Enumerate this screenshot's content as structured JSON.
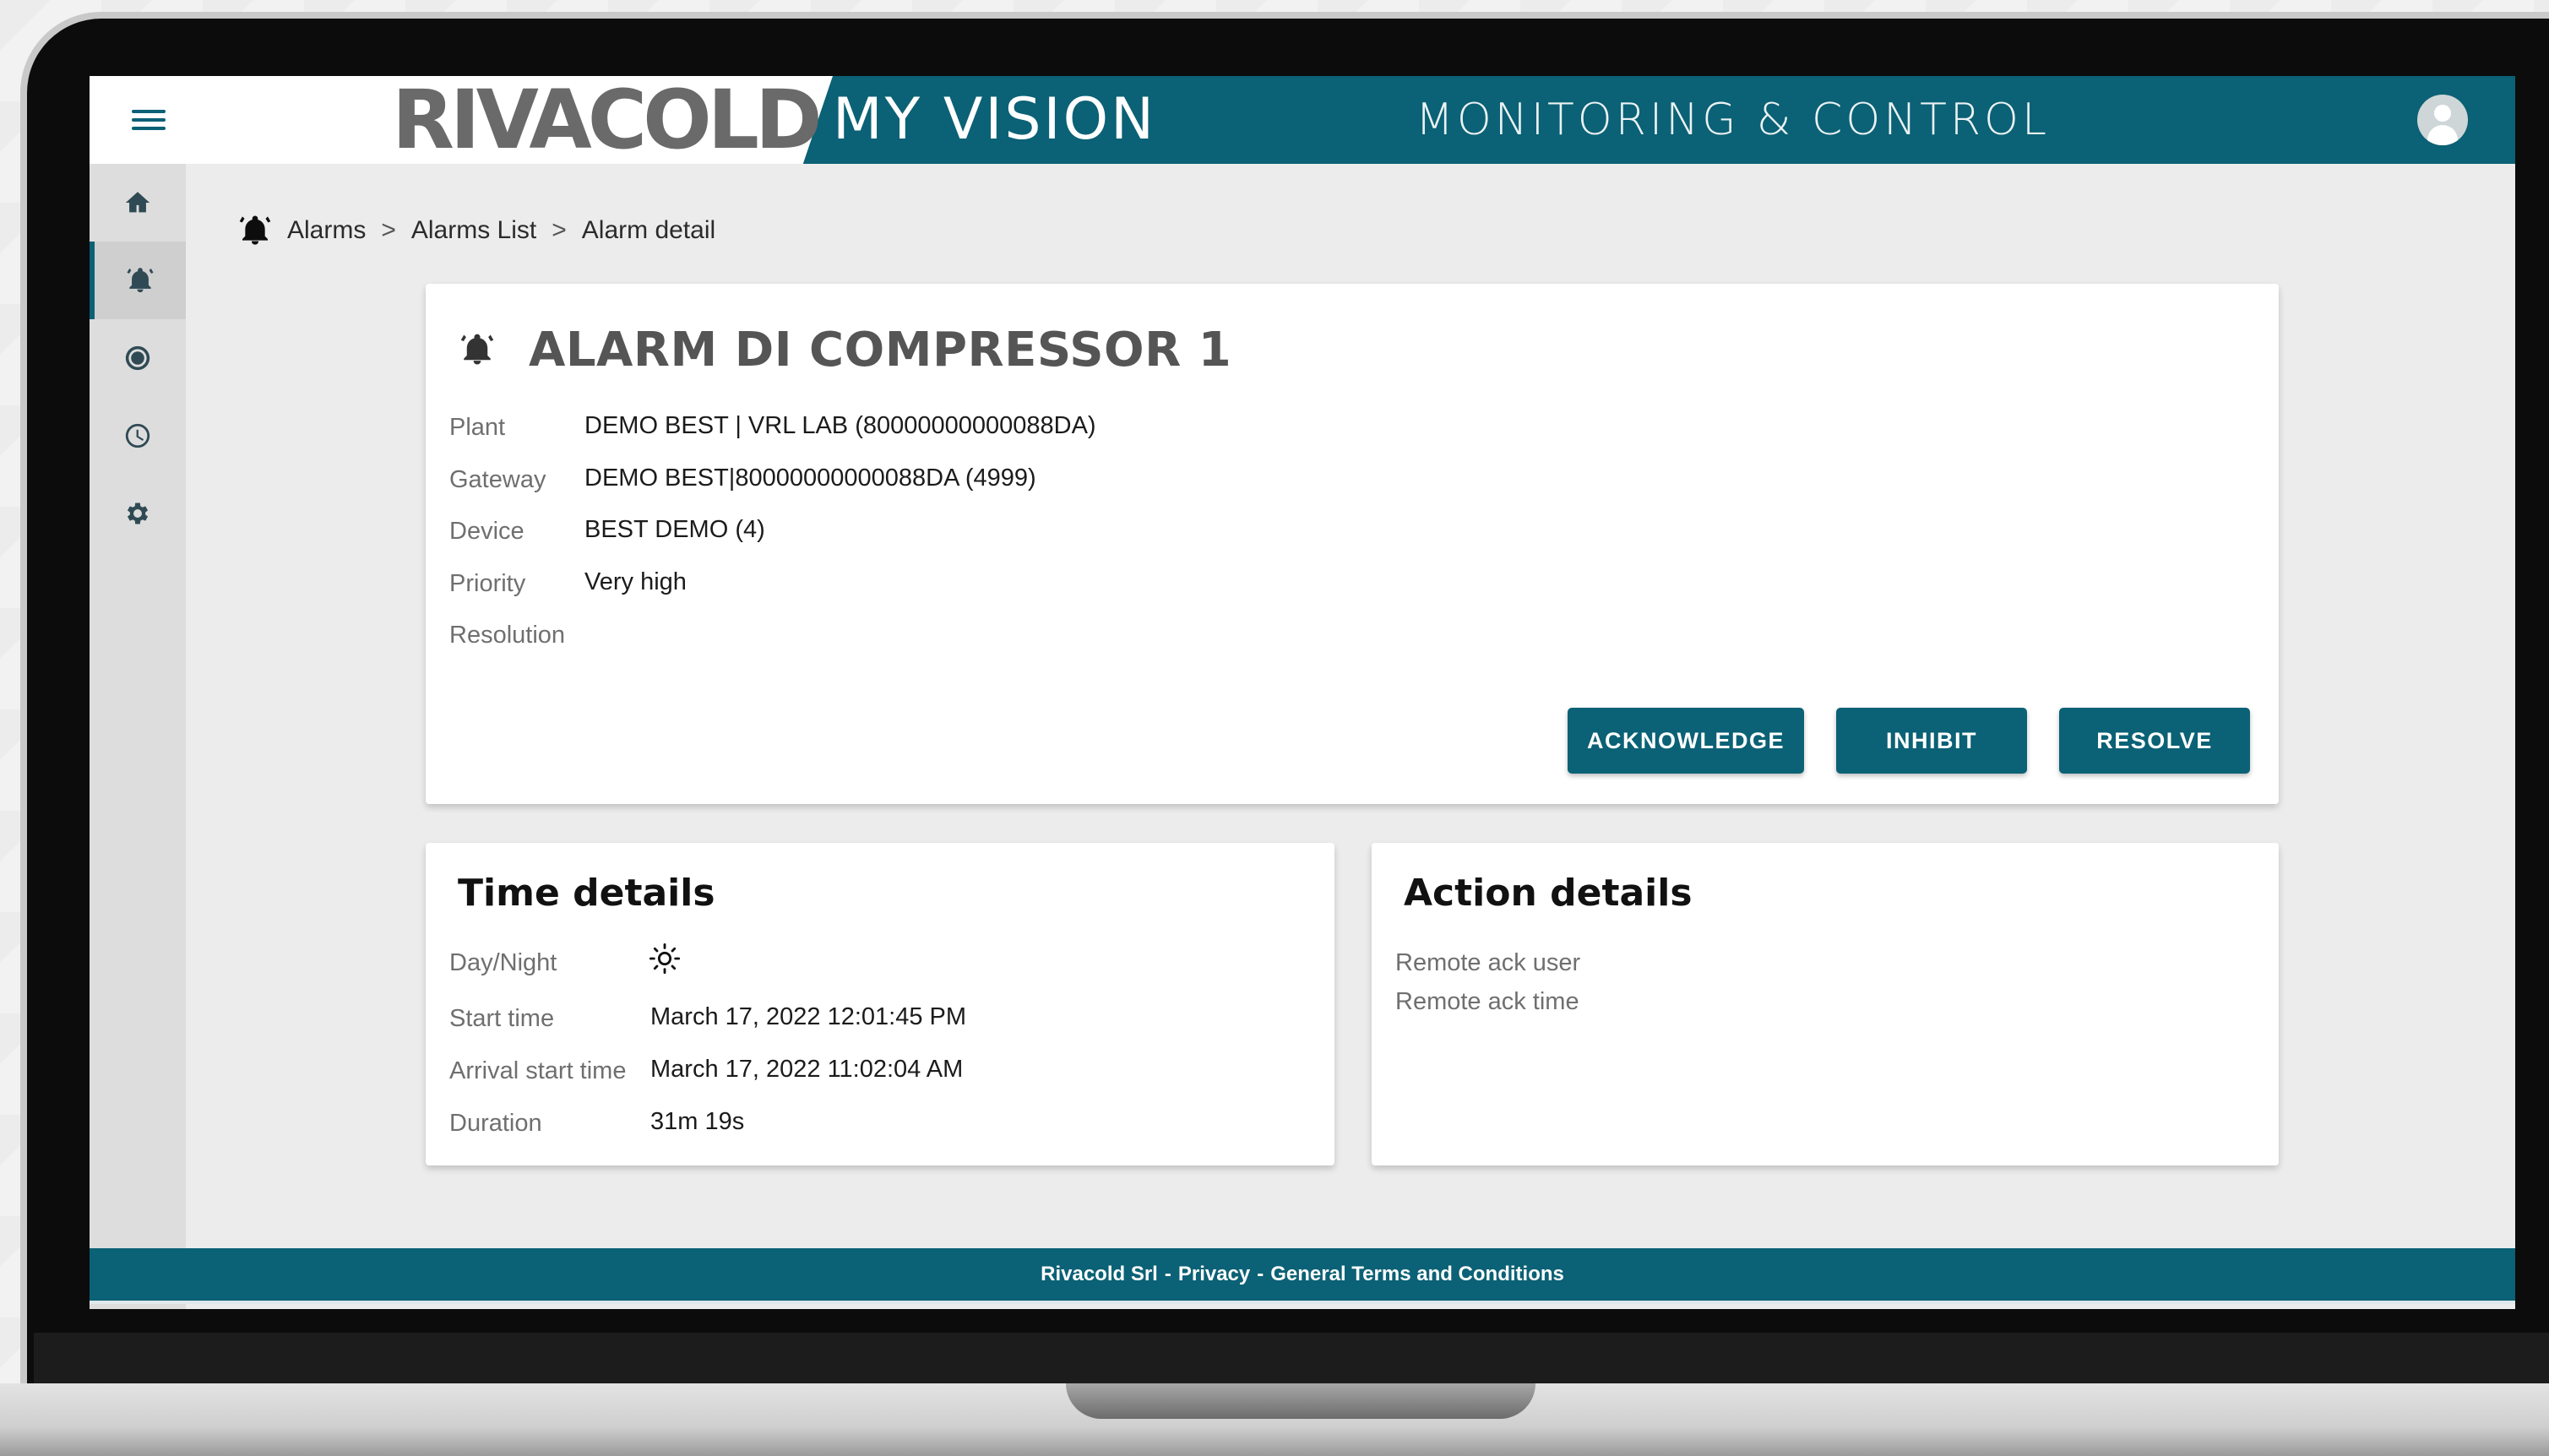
{
  "header": {
    "brand": "RIVACOLD",
    "app_name": "MY VISION",
    "subtitle": "MONITORING & CONTROL"
  },
  "sidebar": {
    "items": [
      {
        "name": "home",
        "icon": "home-icon",
        "active": false
      },
      {
        "name": "alarms",
        "icon": "bell-icon",
        "active": true
      },
      {
        "name": "devices",
        "icon": "target-icon",
        "active": false
      },
      {
        "name": "history",
        "icon": "clock-icon",
        "active": false
      },
      {
        "name": "settings",
        "icon": "gear-icon",
        "active": false
      }
    ]
  },
  "breadcrumb": {
    "items": [
      "Alarms",
      "Alarms List",
      "Alarm detail"
    ],
    "separator": ">"
  },
  "alarm": {
    "title": "ALARM DI COMPRESSOR 1",
    "fields": [
      {
        "label": "Plant",
        "value": "DEMO BEST | VRL LAB (80000000000088DA)"
      },
      {
        "label": "Gateway",
        "value": "DEMO BEST|80000000000088DA (4999)"
      },
      {
        "label": "Device",
        "value": "BEST DEMO (4)"
      },
      {
        "label": "Priority",
        "value": "Very high"
      },
      {
        "label": "Resolution",
        "value": ""
      }
    ],
    "actions": {
      "acknowledge": "ACKNOWLEDGE",
      "inhibit": "INHIBIT",
      "resolve": "RESOLVE"
    }
  },
  "time_details": {
    "title": "Time details",
    "day_night_label": "Day/Night",
    "day_night_icon": "sun-icon",
    "fields": [
      {
        "label": "Start time",
        "value": "March 17, 2022 12:01:45 PM"
      },
      {
        "label": "Arrival start time",
        "value": "March 17, 2022 11:02:04 AM"
      },
      {
        "label": "Duration",
        "value": "31m 19s"
      }
    ]
  },
  "action_details": {
    "title": "Action details",
    "fields": [
      {
        "label": "Remote ack user",
        "value": ""
      },
      {
        "label": "Remote ack time",
        "value": ""
      }
    ]
  },
  "footer": {
    "company": "Rivacold Srl",
    "separator": "-",
    "privacy": "Privacy",
    "terms": "General Terms and Conditions"
  },
  "colors": {
    "primary": "#0b6175",
    "background": "#ececec",
    "sidebar": "#dddddd"
  }
}
